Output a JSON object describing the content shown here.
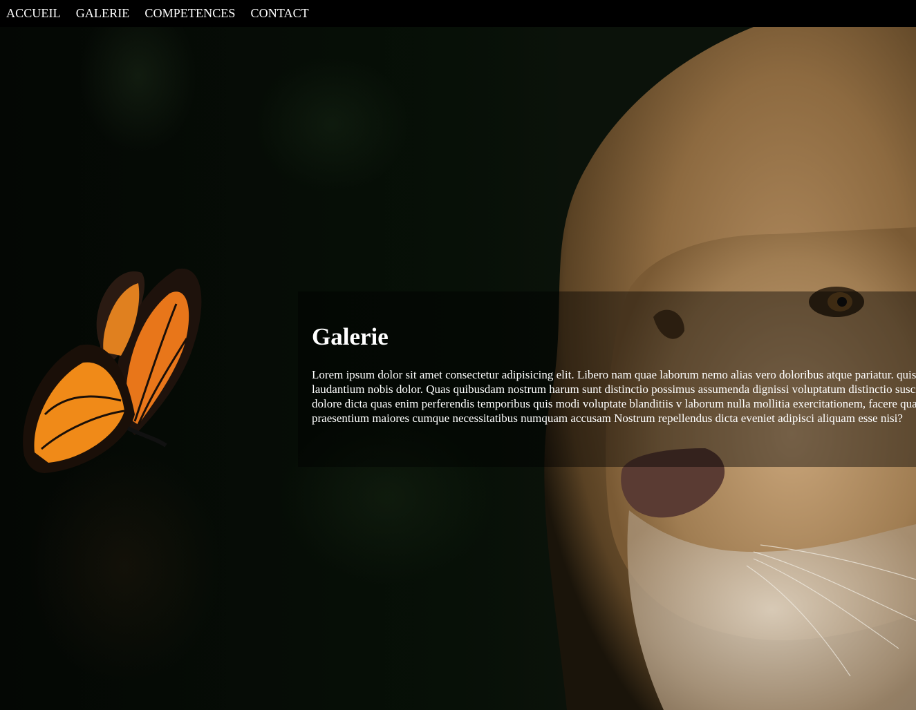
{
  "nav": {
    "items": [
      {
        "label": "ACCUEIL"
      },
      {
        "label": "GALERIE"
      },
      {
        "label": "COMPETENCES"
      },
      {
        "label": "CONTACT"
      }
    ]
  },
  "hero": {
    "title": "Galerie",
    "body": "Lorem ipsum dolor sit amet consectetur adipisicing elit. Libero nam quae laborum nemo alias vero doloribus atque pariatur. quis eum doloremque laudantium nobis dolor. Quas quibusdam nostrum harum sunt distinctio possimus assumenda dignissi voluptatum distinctio suscipit quisquam non dolore dicta quas enim perferendis temporibus quis modi voluptate blanditiis v laborum nulla mollitia exercitationem, facere quas magnam praesentium maiores cumque necessitatibus numquam accusam Nostrum repellendus dicta eveniet adipisci aliquam esse nisi?"
  },
  "colors": {
    "nav_background": "#000000",
    "text": "#ffffff",
    "panel_overlay": "rgba(0,0,0,0.42)"
  }
}
